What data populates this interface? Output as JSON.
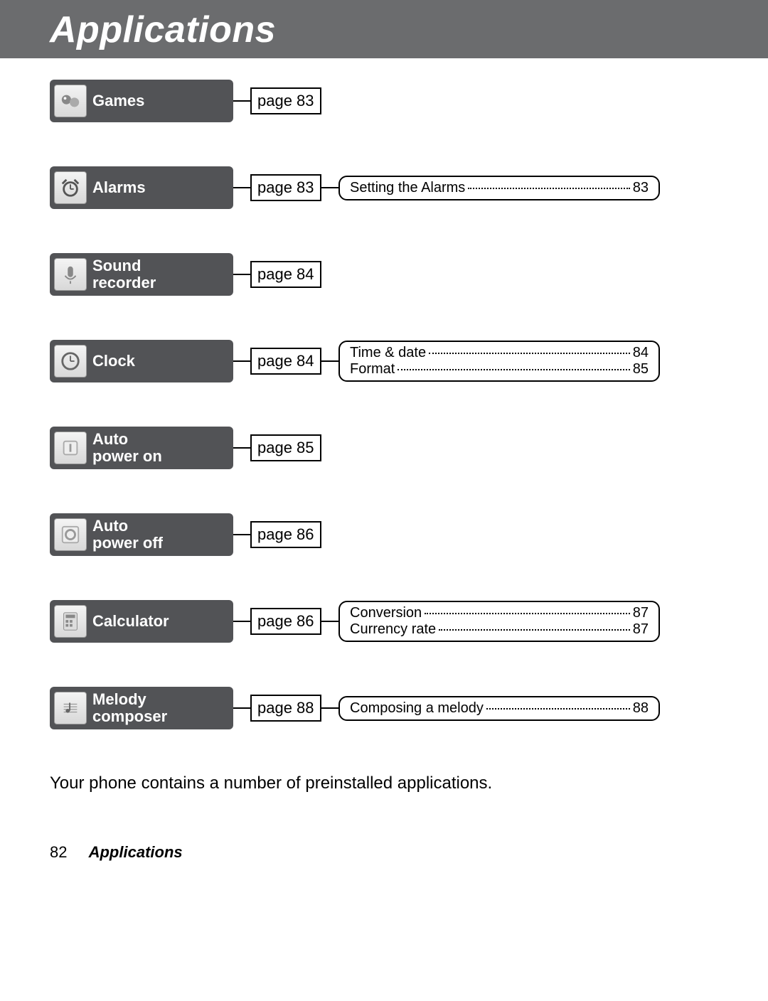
{
  "header": {
    "title": "Applications"
  },
  "rows": [
    {
      "icon": "games-icon",
      "label": "Games",
      "page": "page 83",
      "subs": []
    },
    {
      "icon": "alarms-icon",
      "label": "Alarms",
      "page": "page 83",
      "subs": [
        {
          "label": "Setting the Alarms",
          "page": "83"
        }
      ]
    },
    {
      "icon": "sound-recorder-icon",
      "label": "Sound recorder",
      "page": "page 84",
      "subs": []
    },
    {
      "icon": "clock-icon",
      "label": "Clock",
      "page": "page 84",
      "subs": [
        {
          "label": "Time & date",
          "page": "84"
        },
        {
          "label": "Format",
          "page": "85"
        }
      ]
    },
    {
      "icon": "auto-power-on-icon",
      "label": "Auto power on",
      "page": "page 85",
      "subs": []
    },
    {
      "icon": "auto-power-off-icon",
      "label": "Auto power off",
      "page": "page 86",
      "subs": []
    },
    {
      "icon": "calculator-icon",
      "label": "Calculator",
      "page": "page 86",
      "subs": [
        {
          "label": "Conversion",
          "page": "87"
        },
        {
          "label": "Currency rate",
          "page": "87"
        }
      ]
    },
    {
      "icon": "melody-composer-icon",
      "label": "Melody composer",
      "page": "page 88",
      "subs": [
        {
          "label": "Composing a melody",
          "page": "88"
        }
      ]
    }
  ],
  "body_text": "Your phone contains a number of preinstalled applications.",
  "footer": {
    "page_number": "82",
    "section": "Applications"
  }
}
